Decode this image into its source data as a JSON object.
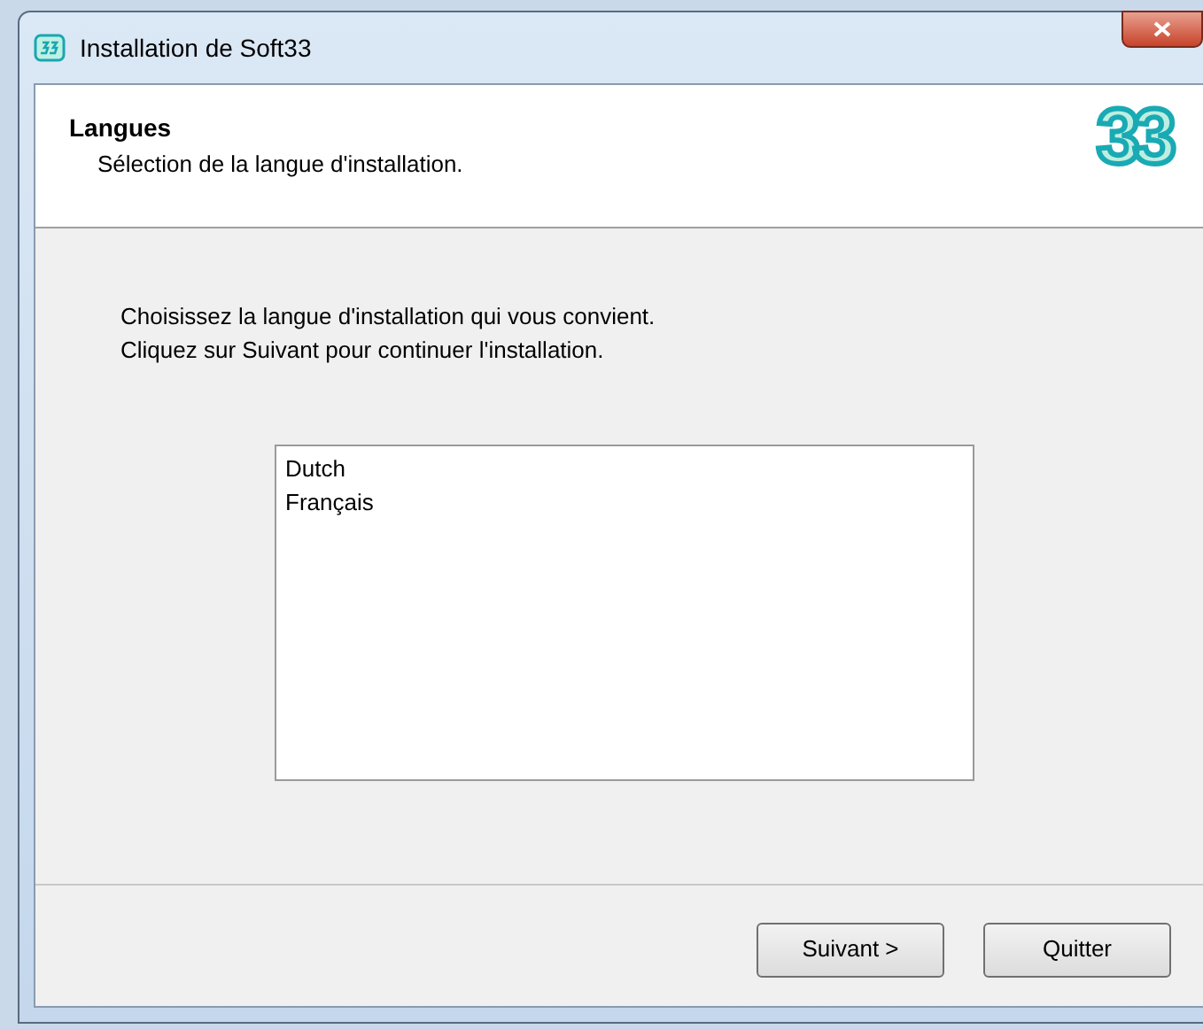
{
  "window": {
    "title": "Installation de Soft33"
  },
  "header": {
    "title": "Langues",
    "subtitle": "Sélection de la langue d'installation.",
    "logo_text": "33"
  },
  "instructions": [
    "Choisissez la langue d'installation qui vous convient.",
    "Cliquez sur Suivant pour continuer l'installation."
  ],
  "languages": [
    {
      "label": "Dutch"
    },
    {
      "label": "Français"
    }
  ],
  "buttons": [
    {
      "label": "Suivant >"
    },
    {
      "label": "Quitter"
    }
  ]
}
